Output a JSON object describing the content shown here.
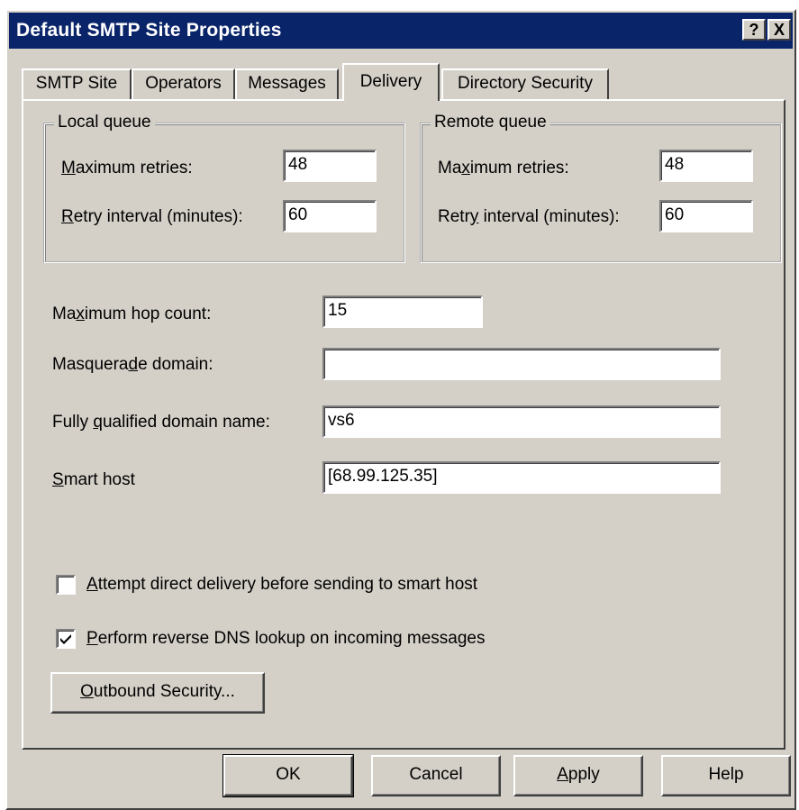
{
  "window": {
    "title": "Default SMTP Site Properties",
    "help_button": "?",
    "close_button": "X"
  },
  "tabs": [
    {
      "label": "SMTP Site",
      "active": false
    },
    {
      "label": "Operators",
      "active": false
    },
    {
      "label": "Messages",
      "active": false
    },
    {
      "label": "Delivery",
      "active": true
    },
    {
      "label": "Directory Security",
      "active": false
    }
  ],
  "local_queue": {
    "title": "Local queue",
    "max_retries_label": "Maximum retries:",
    "max_retries_value": "48",
    "retry_interval_label": "Retry interval (minutes):",
    "retry_interval_value": "60"
  },
  "remote_queue": {
    "title": "Remote queue",
    "max_retries_label": "Maximum retries:",
    "max_retries_value": "48",
    "retry_interval_label": "Retry interval (minutes):",
    "retry_interval_value": "60"
  },
  "fields": {
    "max_hop_label": "Maximum hop count:",
    "max_hop_value": "15",
    "masquerade_label": "Masquerade domain:",
    "masquerade_value": "",
    "fqdn_label": "Fully qualified domain name:",
    "fqdn_value": "vs6",
    "smart_host_label": "Smart host",
    "smart_host_value": "[68.99.125.35]"
  },
  "options": {
    "direct_delivery_label": "Attempt direct delivery before sending to smart host",
    "direct_delivery_checked": false,
    "reverse_dns_label": "Perform reverse DNS lookup on incoming messages",
    "reverse_dns_checked": true
  },
  "outbound_security_button": "Outbound Security...",
  "footer": {
    "ok": "OK",
    "cancel": "Cancel",
    "apply": "Apply",
    "help": "Help"
  },
  "colors": {
    "titlebar": "#0a246a",
    "dialog_face": "#d4d0c8"
  }
}
